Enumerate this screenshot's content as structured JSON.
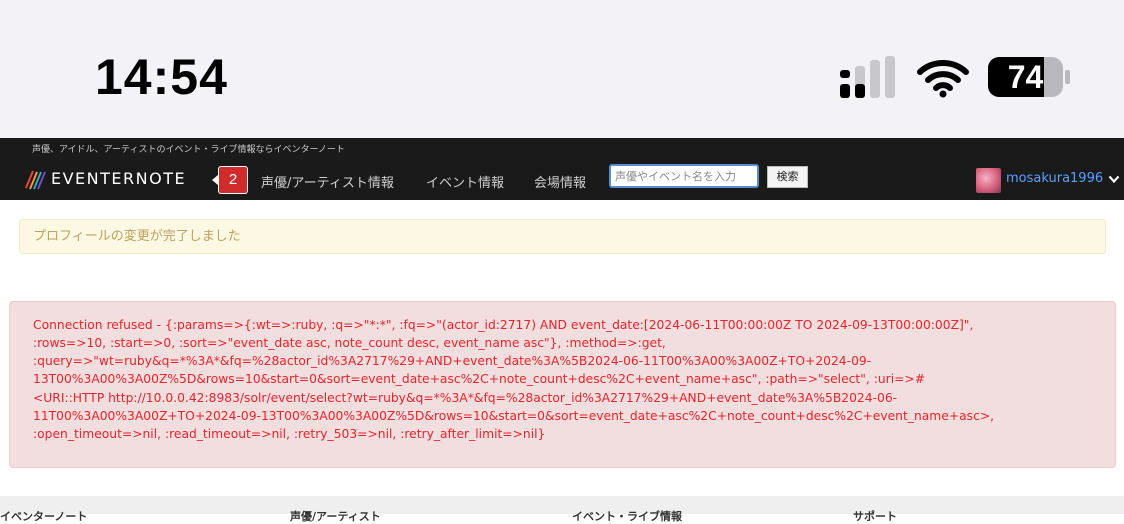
{
  "status_bar": {
    "time": "14:54",
    "battery_level": "74",
    "icons": [
      "cellular-signal-icon",
      "wifi-icon",
      "battery-icon"
    ]
  },
  "header": {
    "tagline": "声優、アイドル、アーティストのイベント・ライブ情報ならイベンターノート",
    "logo_text": "EVENTERNOTE",
    "notification_count": "2",
    "nav": [
      {
        "label": "声優/アーティスト情報"
      },
      {
        "label": "イベント情報"
      },
      {
        "label": "会場情報"
      }
    ],
    "search": {
      "placeholder": "声優やイベント名を入力",
      "value": "",
      "button_label": "検索"
    },
    "user": {
      "username": "mosakura1996"
    }
  },
  "notice": {
    "message": "プロフィールの変更が完了しました"
  },
  "error": {
    "lines": [
      "Connection refused - {:params=>{:wt=>:ruby, :q=>\"*:*\", :fq=>\"(actor_id:2717) AND event_date:[2024-06-11T00:00:00Z TO 2024-09-13T00:00:00Z]\",",
      ":rows=>10, :start=>0, :sort=>\"event_date asc, note_count desc, event_name asc\"}, :method=>:get,",
      ":query=>\"wt=ruby&q=*%3A*&fq=%28actor_id%3A2717%29+AND+event_date%3A%5B2024-06-11T00%3A00%3A00Z+TO+2024-09-",
      "13T00%3A00%3A00Z%5D&rows=10&start=0&sort=event_date+asc%2C+note_count+desc%2C+event_name+asc\", :path=>\"select\", :uri=>#",
      "<URI::HTTP http://10.0.0.42:8983/solr/event/select?wt=ruby&q=*%3A*&fq=%28actor_id%3A2717%29+AND+event_date%3A%5B2024-06-",
      "11T00%3A00%3A00Z+TO+2024-09-13T00%3A00%3A00Z%5D&rows=10&start=0&sort=event_date+asc%2C+note_count+desc%2C+event_name+asc>,",
      ":open_timeout=>nil, :read_timeout=>nil, :retry_503=>nil, :retry_after_limit=>nil}"
    ]
  },
  "footer": {
    "headings": [
      "イベンターノート",
      "声優/アーティスト",
      "イベント・ライブ情報",
      "サポート"
    ]
  },
  "colors": {
    "header_bg": "#1a1a1a",
    "badge": "#d12b2b",
    "username": "#5aa0ff",
    "notice_bg": "#fcf8e3",
    "notice_text": "#c0a15e",
    "error_bg": "#f2dede",
    "error_text": "#e8232a"
  }
}
